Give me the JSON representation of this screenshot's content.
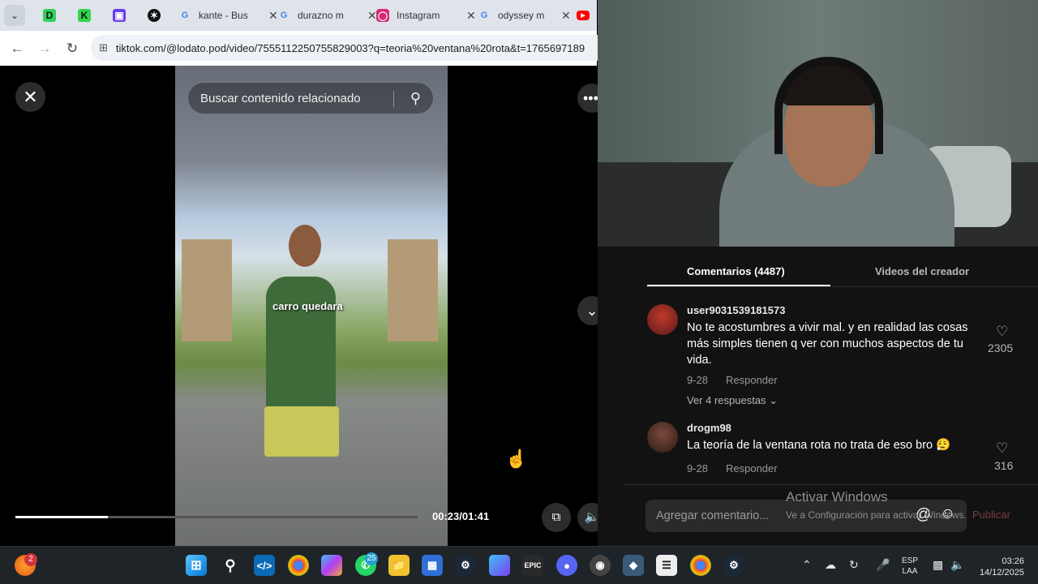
{
  "browser": {
    "tabs": [
      {
        "title": "kante - Bus",
        "favicon": "google-icon"
      },
      {
        "title": "durazno m",
        "favicon": "google-icon"
      },
      {
        "title": "Instagram",
        "favicon": "instagram-icon"
      },
      {
        "title": "odyssey m",
        "favicon": "google-icon"
      }
    ],
    "url": "tiktok.com/@lodato.pod/video/7555112250755829003?q=teoria%20ventana%20rota&t=1765697189"
  },
  "video": {
    "search_placeholder": "Buscar contenido relacionado",
    "caption": "carro quedara",
    "time": "00:23/01:41",
    "progress": 0.23
  },
  "panel": {
    "tabs": {
      "comments": "Comentarios (4487)",
      "creator_videos": "Videos del creador"
    },
    "comments": [
      {
        "user": "user9031539181573",
        "text": "No te acostumbres a vivir mal. y en realidad las cosas más simples tienen q ver con muchos aspectos de tu vida.",
        "date": "9-28",
        "reply_label": "Responder",
        "likes": "2305",
        "view_replies": "Ver 4 respuestas"
      },
      {
        "user": "drogm98",
        "text": "La teoría de la ventana rota no trata de eso bro 😮‍💨",
        "date": "9-28",
        "reply_label": "Responder",
        "likes": "316"
      }
    ],
    "comment_placeholder": "Agregar comentario...",
    "publish_label": "Publicar"
  },
  "windows_activation": {
    "title": "Activar Windows",
    "subtitle": "Ve a Configuración para activar Windows."
  },
  "taskbar": {
    "notification_badge": "2",
    "whatsapp_badge": "25",
    "language": "ESP",
    "keyboard": "LAA",
    "time": "03:26",
    "date": "14/12/2025"
  }
}
